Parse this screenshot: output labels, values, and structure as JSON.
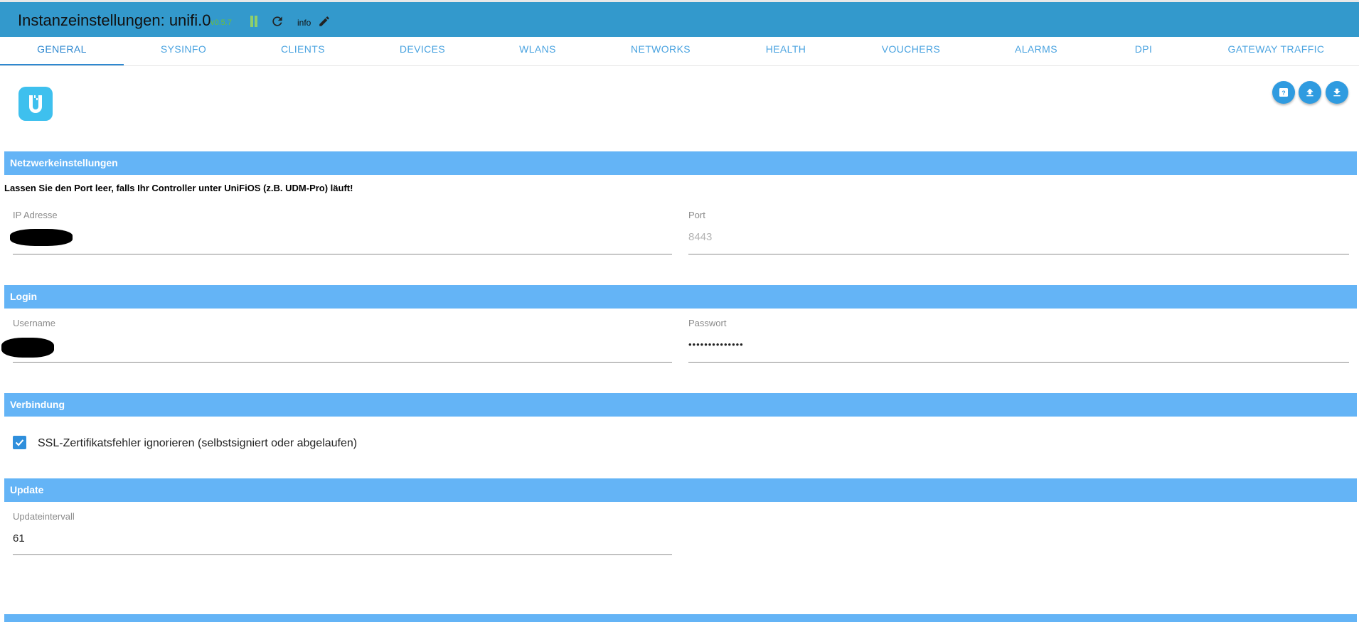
{
  "header": {
    "title": "Instanzeinstellungen: unifi.0",
    "version": "v0.5.7",
    "loglevel": "info"
  },
  "tabs": [
    {
      "label": "GENERAL",
      "active": true
    },
    {
      "label": "SYSINFO"
    },
    {
      "label": "CLIENTS"
    },
    {
      "label": "DEVICES"
    },
    {
      "label": "WLANS"
    },
    {
      "label": "NETWORKS"
    },
    {
      "label": "HEALTH"
    },
    {
      "label": "VOUCHERS"
    },
    {
      "label": "ALARMS"
    },
    {
      "label": "DPI"
    },
    {
      "label": "GATEWAY TRAFFIC"
    }
  ],
  "sections": {
    "network": {
      "title": "Netzwerkeinstellungen",
      "notice": "Lassen Sie den Port leer, falls Ihr Controller unter UniFiOS (z.B. UDM-Pro) läuft!",
      "ip_label": "IP Adresse",
      "port_label": "Port",
      "port_placeholder": "8443"
    },
    "login": {
      "title": "Login",
      "username_label": "Username",
      "password_label": "Passwort",
      "password_value": "••••••••••••••"
    },
    "connection": {
      "title": "Verbindung",
      "ssl_label": "SSL-Zertifikatsfehler ignorieren (selbstsigniert oder abgelaufen)",
      "ssl_checked": true
    },
    "update": {
      "title": "Update",
      "interval_label": "Updateintervall",
      "interval_value": "61"
    }
  },
  "colors": {
    "topbar": "#3399cc",
    "section_header": "#64b4f6",
    "accent": "#2f9be0"
  }
}
